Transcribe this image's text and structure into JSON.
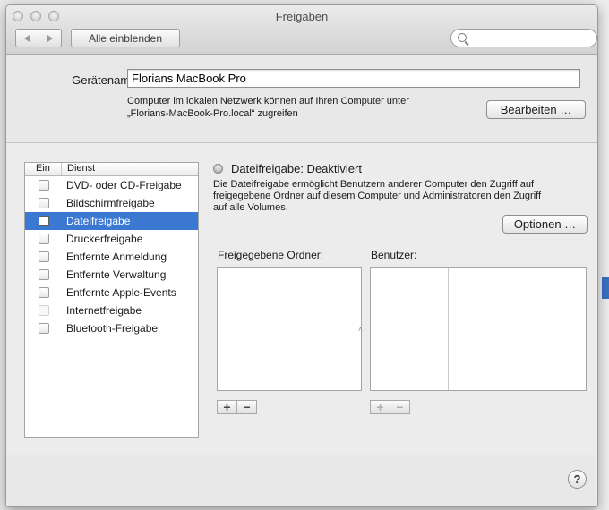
{
  "window": {
    "title": "Freigaben"
  },
  "toolbar": {
    "back_icon": "chevron-left-icon",
    "forward_icon": "chevron-right-icon",
    "show_all_label": "Alle einblenden",
    "search_placeholder": ""
  },
  "device": {
    "label": "Gerätename:",
    "value": "Florians MacBook Pro",
    "info_line1": "Computer im lokalen Netzwerk können auf Ihren Computer unter",
    "info_line2": "„Florians-MacBook-Pro.local“ zugreifen",
    "edit_button": "Bearbeiten …"
  },
  "services": {
    "header_on": "Ein",
    "header_service": "Dienst",
    "items": [
      {
        "label": "DVD- oder CD-Freigabe",
        "checked": false
      },
      {
        "label": "Bildschirmfreigabe",
        "checked": false
      },
      {
        "label": "Dateifreigabe",
        "checked": false,
        "selected": true
      },
      {
        "label": "Druckerfreigabe",
        "checked": false
      },
      {
        "label": "Entfernte Anmeldung",
        "checked": false
      },
      {
        "label": "Entfernte Verwaltung",
        "checked": false
      },
      {
        "label": "Entfernte Apple-Events",
        "checked": false
      },
      {
        "label": "Internetfreigabe",
        "checked": false,
        "disabled": true
      },
      {
        "label": "Bluetooth-Freigabe",
        "checked": false
      }
    ]
  },
  "detail": {
    "status": "Dateifreigabe: Deaktiviert",
    "description_line1": "Die Dateifreigabe ermöglicht Benutzern anderer Computer den Zugriff auf",
    "description_line2": "freigegebene Ordner auf diesem Computer und Administratoren den Zugriff",
    "description_line3": "auf alle Volumes.",
    "options_button": "Optionen …",
    "shared_folders_label": "Freigegebene Ordner:",
    "users_label": "Benutzer:",
    "add_symbol": "+",
    "remove_symbol": "−"
  },
  "help": {
    "symbol": "?"
  },
  "colors": {
    "selection": "#3b78d1",
    "window_bg": "#ececec"
  }
}
